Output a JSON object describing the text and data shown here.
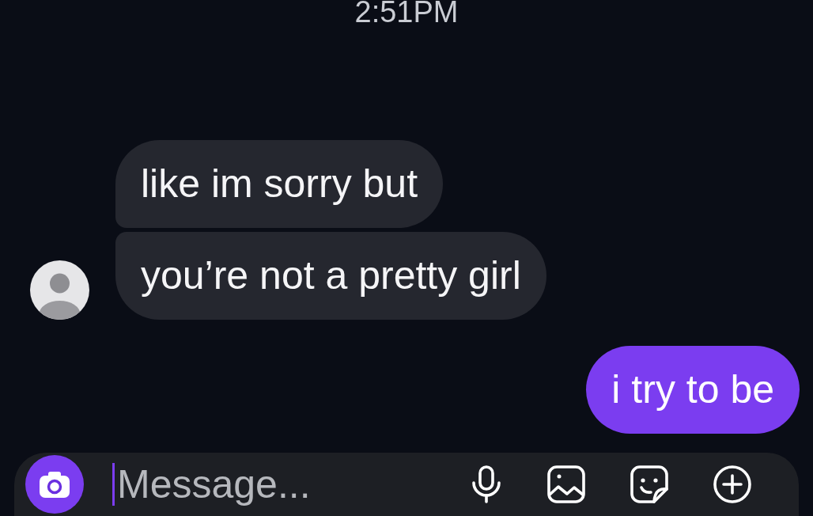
{
  "timestamp": "2:51PM",
  "messages": [
    {
      "kind": "received",
      "text": "like im sorry but",
      "avatar": false
    },
    {
      "kind": "received",
      "text": "you’re not a pretty girl",
      "avatar": true
    },
    {
      "kind": "sent",
      "text": "i try to be",
      "avatar": false
    }
  ],
  "composer": {
    "placeholder": "Message...",
    "focused": true
  }
}
